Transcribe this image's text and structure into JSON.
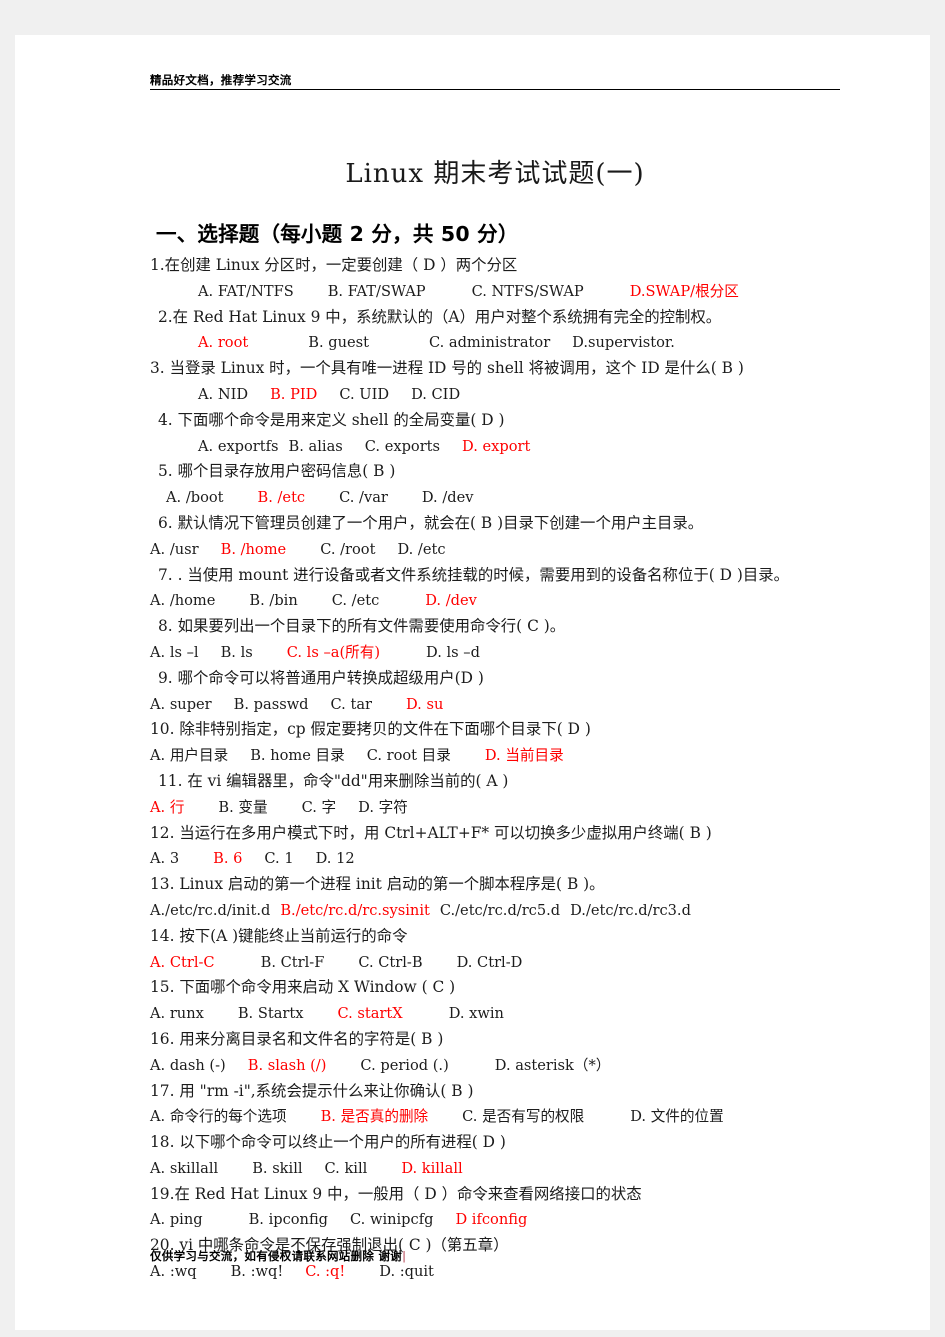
{
  "header": {
    "text": "精品好文档，推荐学习交流"
  },
  "title": {
    "main": "Linux  期末考试试题(一)"
  },
  "section": {
    "heading": "一、选择题（每小题 2 分，共 50 分）"
  },
  "colors": {
    "answer_red": "#ff0000",
    "body_text": "#1c1c1c",
    "page_background": "#ffffff",
    "canvas_background": "#f0f0f0"
  },
  "questions": [
    {
      "number": "1.",
      "stem_pre": "1.在创建 Linux 分区时，一定要创建（ D ）两个分区",
      "stem_indent": "ind0",
      "opts_indent": "ind4",
      "options": [
        {
          "label": "A. FAT/NTFS",
          "red": false,
          "gap": "sp3"
        },
        {
          "label": "B. FAT/SWAP",
          "red": false,
          "gap": "sp4"
        },
        {
          "label": "C. NTFS/SWAP",
          "red": false,
          "gap": "sp4"
        },
        {
          "label": "D.SWAP/根分区",
          "red": true,
          "gap": ""
        }
      ]
    },
    {
      "number": "2.",
      "stem_pre": "2.在 Red Hat Linux 9 中，系统默认的（A）用户对整个系统拥有完全的控制权。",
      "stem_indent": "ind1",
      "opts_indent": "ind4",
      "options": [
        {
          "label": "A. root",
          "red": true,
          "gap": "sp5"
        },
        {
          "label": "B. guest",
          "red": false,
          "gap": "sp5"
        },
        {
          "label": "C. administrator",
          "red": false,
          "gap": "sp2"
        },
        {
          "label": "D.supervistor.",
          "red": false,
          "gap": ""
        }
      ]
    },
    {
      "number": "3.",
      "stem_pre": "3. 当登录 Linux 时，一个具有唯一进程 ID 号的 shell 将被调用，这个 ID 是什么( B  )",
      "stem_indent": "ind0",
      "opts_indent": "ind4",
      "options": [
        {
          "label": "A. NID",
          "red": false,
          "gap": "sp2"
        },
        {
          "label": "B. PID",
          "red": true,
          "gap": "sp2"
        },
        {
          "label": "C. UID",
          "red": false,
          "gap": "sp2"
        },
        {
          "label": "D. CID",
          "red": false,
          "gap": ""
        }
      ]
    },
    {
      "number": "4.",
      "stem_pre": "4. 下面哪个命令是用来定义 shell 的全局变量( D  )",
      "stem_indent": "ind1",
      "opts_indent": "ind4",
      "options": [
        {
          "label": "A. exportfs",
          "red": false,
          "gap": "sp1"
        },
        {
          "label": "B. alias",
          "red": false,
          "gap": "sp2"
        },
        {
          "label": "C. exports",
          "red": false,
          "gap": "sp2"
        },
        {
          "label": "D. export",
          "red": true,
          "gap": ""
        }
      ]
    },
    {
      "number": "5.",
      "stem_pre": "5. 哪个目录存放用户密码信息( B  )",
      "stem_indent": "ind1",
      "opts_indent": "ind2",
      "options": [
        {
          "label": "A. /boot",
          "red": false,
          "gap": "sp3"
        },
        {
          "label": "B. /etc",
          "red": true,
          "gap": "sp3"
        },
        {
          "label": "C. /var",
          "red": false,
          "gap": "sp3"
        },
        {
          "label": "D. /dev",
          "red": false,
          "gap": ""
        }
      ]
    },
    {
      "number": "6.",
      "stem_pre": "6. 默认情况下管理员创建了一个用户，就会在( B  )目录下创建一个用户主目录。",
      "stem_indent": "ind1",
      "opts_indent": "ind0",
      "options": [
        {
          "label": "A. /usr",
          "red": false,
          "gap": "sp2"
        },
        {
          "label": "B. /home",
          "red": true,
          "gap": "sp3"
        },
        {
          "label": "C. /root",
          "red": false,
          "gap": "sp2"
        },
        {
          "label": "D. /etc",
          "red": false,
          "gap": ""
        }
      ]
    },
    {
      "number": "7.",
      "stem_pre": "7. . 当使用 mount 进行设备或者文件系统挂载的时候，需要用到的设备名称位于( D )目录。",
      "stem_indent": "ind1",
      "opts_indent": "ind0",
      "options": [
        {
          "label": "A. /home",
          "red": false,
          "gap": "sp3"
        },
        {
          "label": "B. /bin",
          "red": false,
          "gap": "sp3"
        },
        {
          "label": "C. /etc",
          "red": false,
          "gap": "sp4"
        },
        {
          "label": "D. /dev",
          "red": true,
          "gap": ""
        }
      ]
    },
    {
      "number": "8.",
      "stem_pre": "8. 如果要列出一个目录下的所有文件需要使用命令行( C  )。",
      "stem_indent": "ind1",
      "opts_indent": "ind0",
      "options": [
        {
          "label": "A. ls –l",
          "red": false,
          "gap": "sp2"
        },
        {
          "label": "B. ls",
          "red": false,
          "gap": "sp3"
        },
        {
          "label": "C. ls –a(所有)",
          "red": true,
          "gap": "sp4"
        },
        {
          "label": "D. ls –d",
          "red": false,
          "gap": ""
        }
      ]
    },
    {
      "number": "9.",
      "stem_pre": "9. 哪个命令可以将普通用户转换成超级用户(D )",
      "stem_indent": "ind1",
      "opts_indent": "ind0",
      "options": [
        {
          "label": "A. super",
          "red": false,
          "gap": "sp2"
        },
        {
          "label": "B. passwd",
          "red": false,
          "gap": "sp2"
        },
        {
          "label": "C. tar",
          "red": false,
          "gap": "sp3"
        },
        {
          "label": "D. su",
          "red": true,
          "gap": ""
        }
      ]
    },
    {
      "number": "10.",
      "stem_pre": "10. 除非特别指定，cp 假定要拷贝的文件在下面哪个目录下( D  )",
      "stem_indent": "ind0",
      "opts_indent": "ind0",
      "options": [
        {
          "label": "A. 用户目录",
          "red": false,
          "gap": "sp2"
        },
        {
          "label": "B. home 目录",
          "red": false,
          "gap": "sp2"
        },
        {
          "label": "C. root 目录",
          "red": false,
          "gap": "sp3"
        },
        {
          "label": "D. 当前目录",
          "red": true,
          "gap": ""
        }
      ]
    },
    {
      "number": "11.",
      "stem_pre": "11. 在 vi 编辑器里，命令\"dd\"用来删除当前的( A )",
      "stem_indent": "ind1",
      "opts_indent": "ind0",
      "options": [
        {
          "label": "A. 行",
          "red": true,
          "gap": "sp3"
        },
        {
          "label": "B. 变量",
          "red": false,
          "gap": "sp3"
        },
        {
          "label": "C. 字",
          "red": false,
          "gap": "sp2"
        },
        {
          "label": "D. 字符",
          "red": false,
          "gap": ""
        }
      ]
    },
    {
      "number": "12.",
      "stem_pre": "12. 当运行在多用户模式下时，用 Ctrl+ALT+F* 可以切换多少虚拟用户终端( B  )",
      "stem_indent": "ind0",
      "opts_indent": "ind0",
      "options": [
        {
          "label": "A. 3",
          "red": false,
          "gap": "sp3"
        },
        {
          "label": "B. 6",
          "red": true,
          "gap": "sp2"
        },
        {
          "label": "C. 1",
          "red": false,
          "gap": "sp2"
        },
        {
          "label": "D. 12",
          "red": false,
          "gap": ""
        }
      ]
    },
    {
      "number": "13.",
      "stem_pre": "13. Linux 启动的第一个进程 init 启动的第一个脚本程序是( B  )。",
      "stem_indent": "ind0",
      "opts_indent": "ind0",
      "options": [
        {
          "label": "A./etc/rc.d/init.d",
          "red": false,
          "gap": "sp1"
        },
        {
          "label": "B./etc/rc.d/rc.sysinit",
          "red": true,
          "gap": "sp1"
        },
        {
          "label": "C./etc/rc.d/rc5.d",
          "red": false,
          "gap": "sp1"
        },
        {
          "label": "D./etc/rc.d/rc3.d",
          "red": false,
          "gap": ""
        }
      ]
    },
    {
      "number": "14.",
      "stem_pre": "14. 按下(A    )键能终止当前运行的命令",
      "stem_indent": "ind0",
      "opts_indent": "ind0",
      "options": [
        {
          "label": "A. Ctrl-C",
          "red": true,
          "gap": "sp4"
        },
        {
          "label": "B. Ctrl-F",
          "red": false,
          "gap": "sp3"
        },
        {
          "label": "C. Ctrl-B",
          "red": false,
          "gap": "sp3"
        },
        {
          "label": "D. Ctrl-D",
          "red": false,
          "gap": ""
        }
      ]
    },
    {
      "number": "15.",
      "stem_pre": "15. 下面哪个命令用来启动 X Window ( C  )",
      "stem_indent": "ind0",
      "opts_indent": "ind0",
      "options": [
        {
          "label": "A. runx",
          "red": false,
          "gap": "sp3"
        },
        {
          "label": "B. Startx",
          "red": false,
          "gap": "sp3"
        },
        {
          "label": "C. startX",
          "red": true,
          "gap": "sp4"
        },
        {
          "label": "D. xwin",
          "red": false,
          "gap": ""
        }
      ]
    },
    {
      "number": "16.",
      "stem_pre": "16. 用来分离目录名和文件名的字符是( B  )",
      "stem_indent": "ind0",
      "opts_indent": "ind0",
      "options": [
        {
          "label": "A. dash (-)",
          "red": false,
          "gap": "sp2"
        },
        {
          "label": "B. slash (/)",
          "red": true,
          "gap": "sp3"
        },
        {
          "label": "C. period (.)",
          "red": false,
          "gap": "sp4"
        },
        {
          "label": "D. asterisk（*）",
          "red": false,
          "gap": ""
        }
      ]
    },
    {
      "number": "17.",
      "stem_pre": "17. 用 \"rm -i\",系统会提示什么来让你确认(  B  )",
      "stem_indent": "ind0",
      "opts_indent": "ind0",
      "options": [
        {
          "label": "A. 命令行的每个选项",
          "red": false,
          "gap": "sp3"
        },
        {
          "label": "B. 是否真的删除",
          "red": true,
          "gap": "sp3"
        },
        {
          "label": "C. 是否有写的权限",
          "red": false,
          "gap": "sp4"
        },
        {
          "label": "D. 文件的位置",
          "red": false,
          "gap": ""
        }
      ]
    },
    {
      "number": "18.",
      "stem_pre": "18. 以下哪个命令可以终止一个用户的所有进程( D  )",
      "stem_indent": "ind0",
      "opts_indent": "ind0",
      "options": [
        {
          "label": "A. skillall",
          "red": false,
          "gap": "sp3"
        },
        {
          "label": "B. skill",
          "red": false,
          "gap": "sp2"
        },
        {
          "label": "C. kill",
          "red": false,
          "gap": "sp3"
        },
        {
          "label": "D. killall",
          "red": true,
          "gap": ""
        }
      ]
    },
    {
      "number": "19.",
      "stem_pre": "19.在 Red Hat Linux 9 中，一般用（ D  ）命令来查看网络接口的状态",
      "stem_indent": "ind0",
      "opts_indent": "ind0",
      "options": [
        {
          "label": "A. ping",
          "red": false,
          "gap": "sp4"
        },
        {
          "label": "B. ipconfig",
          "red": false,
          "gap": "sp2"
        },
        {
          "label": "C. winipcfg",
          "red": false,
          "gap": "sp2"
        },
        {
          "label": "D   ifconfig",
          "red": true,
          "gap": ""
        }
      ]
    },
    {
      "number": "20.",
      "stem_pre": "20. vi 中哪条命令是不保存强制退出( C  )（第五章）",
      "stem_indent": "ind0",
      "opts_indent": "ind0",
      "options": [
        {
          "label": "A. :wq",
          "red": false,
          "gap": "sp3"
        },
        {
          "label": "B. :wq!",
          "red": false,
          "gap": "sp2"
        },
        {
          "label": "C. :q!",
          "red": true,
          "gap": "sp3"
        },
        {
          "label": "D. :quit",
          "red": false,
          "gap": ""
        }
      ]
    }
  ],
  "footer": {
    "text": "仅供学习与交流，如有侵权请联系网站删除 谢谢",
    "caret": "|"
  }
}
